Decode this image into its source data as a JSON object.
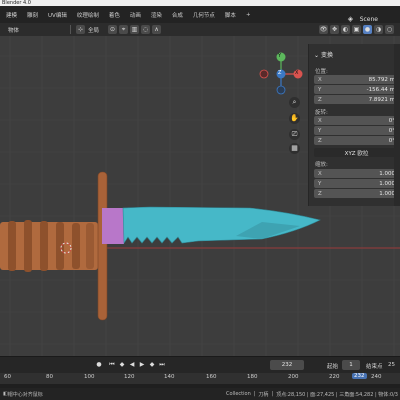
{
  "window": {
    "title": "Blender 4.0"
  },
  "menubar": {
    "items": [
      "建模",
      "雕刻",
      "UV编辑",
      "纹理绘制",
      "着色",
      "动画",
      "渲染",
      "合成",
      "几何节点",
      "脚本"
    ],
    "add_tab": "+",
    "scene_name": "Scene"
  },
  "header": {
    "mode": "物体",
    "transform_orientation": "全局"
  },
  "viewport": {
    "nav_gizmo": {
      "x": "X",
      "y": "Y",
      "z": "Z"
    }
  },
  "npanel": {
    "transform_title": "变换",
    "location": {
      "label": "位置:",
      "x": "85.792 m",
      "y": "-156.44 m",
      "z": "7.8921 m"
    },
    "rotation": {
      "label": "旋转:",
      "x": "0°",
      "y": "0°",
      "z": "0°",
      "mode": "XYZ 欧拉"
    },
    "scale": {
      "label": "缩放:",
      "x": "1.000",
      "y": "1.000",
      "z": "1.000"
    },
    "axis": {
      "x": "X",
      "y": "Y",
      "z": "Z"
    }
  },
  "timeline": {
    "current_frame": "232",
    "start_label": "起始",
    "start_value": "1",
    "end_label": "结束点",
    "end_value": "25",
    "ruler": [
      "60",
      "80",
      "100",
      "120",
      "140",
      "160",
      "180",
      "200",
      "220",
      "232",
      "240"
    ]
  },
  "statusbar": {
    "left": "帽中心对齐鼠标",
    "collection": "Collection",
    "object": "刀柄",
    "stats": "顶点:28,150 | 面:27,425 | 三角面:54,282 | 物体:0/3"
  },
  "colors": {
    "blade": "#46b8c8",
    "guard": "#b877c9",
    "handle": "#b06a3e",
    "axis_red": "#9a3b3b"
  }
}
